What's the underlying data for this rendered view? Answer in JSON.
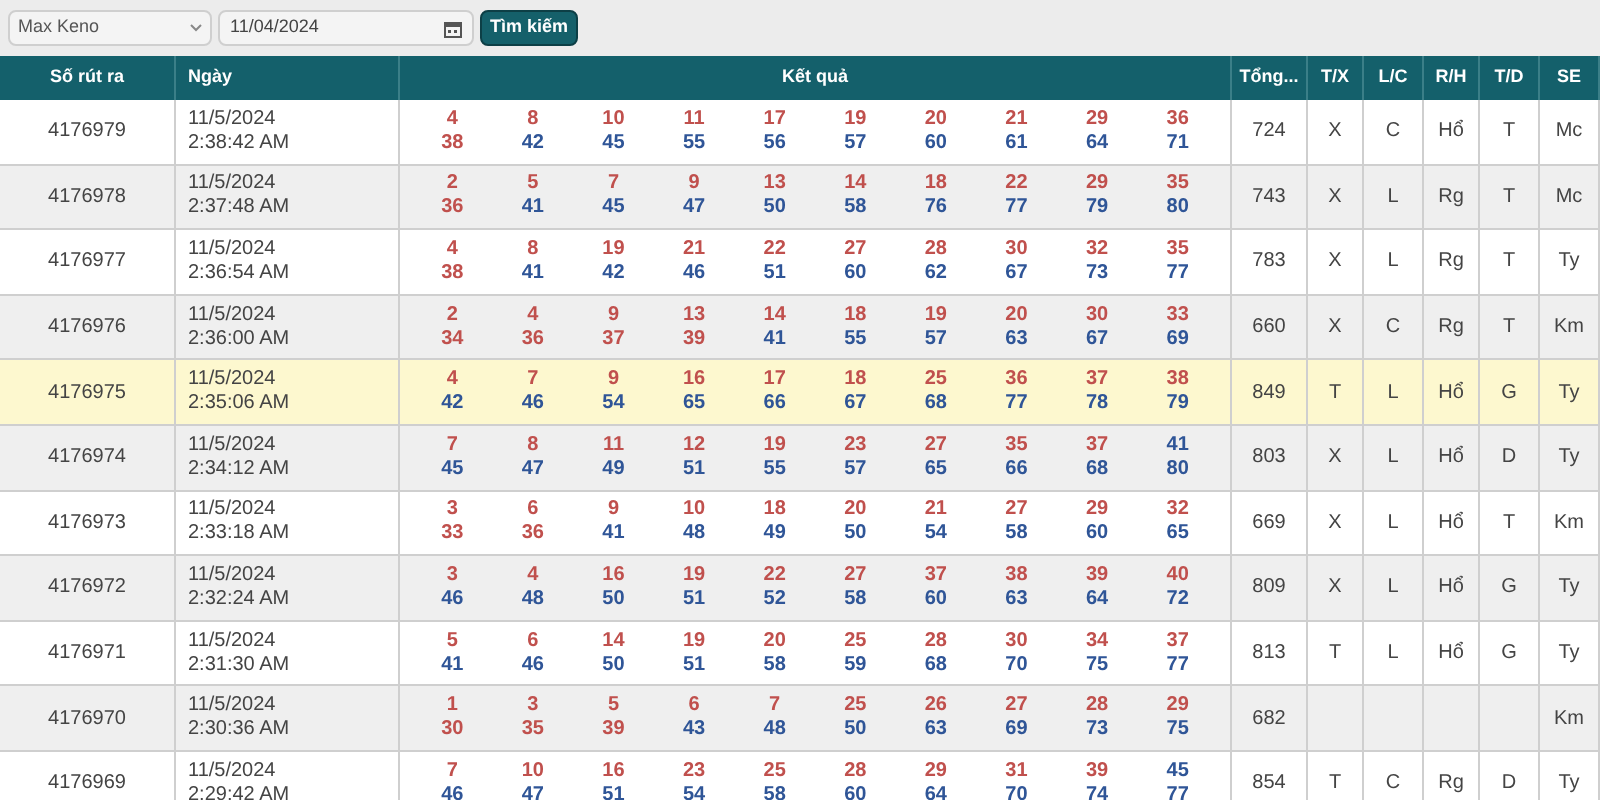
{
  "toolbar": {
    "game": "Max Keno",
    "date": "11/04/2024",
    "search_button": "Tìm kiếm"
  },
  "table": {
    "columns": [
      "Số rút ra",
      "Ngày",
      "Kết quả",
      "Tổng...",
      "T/X",
      "L/C",
      "R/H",
      "T/D",
      "SE"
    ],
    "rows": [
      {
        "draw": "4176979",
        "date": "11/5/2024",
        "time": "2:38:42 AM",
        "selected": false,
        "numbers": [
          "4",
          "8",
          "10",
          "11",
          "17",
          "19",
          "20",
          "21",
          "29",
          "36",
          "38",
          "42",
          "45",
          "55",
          "56",
          "57",
          "60",
          "61",
          "64",
          "71"
        ],
        "total": "724",
        "tx": "X",
        "lc": "C",
        "rh": "Hổ",
        "td": "T",
        "se": "Mc"
      },
      {
        "draw": "4176978",
        "date": "11/5/2024",
        "time": "2:37:48 AM",
        "selected": false,
        "numbers": [
          "2",
          "5",
          "7",
          "9",
          "13",
          "14",
          "18",
          "22",
          "29",
          "35",
          "36",
          "41",
          "45",
          "47",
          "50",
          "58",
          "76",
          "77",
          "79",
          "80"
        ],
        "total": "743",
        "tx": "X",
        "lc": "L",
        "rh": "Rg",
        "td": "T",
        "se": "Mc"
      },
      {
        "draw": "4176977",
        "date": "11/5/2024",
        "time": "2:36:54 AM",
        "selected": false,
        "numbers": [
          "4",
          "8",
          "19",
          "21",
          "22",
          "27",
          "28",
          "30",
          "32",
          "35",
          "38",
          "41",
          "42",
          "46",
          "51",
          "60",
          "62",
          "67",
          "73",
          "77"
        ],
        "total": "783",
        "tx": "X",
        "lc": "L",
        "rh": "Rg",
        "td": "T",
        "se": "Ty"
      },
      {
        "draw": "4176976",
        "date": "11/5/2024",
        "time": "2:36:00 AM",
        "selected": false,
        "numbers": [
          "2",
          "4",
          "9",
          "13",
          "14",
          "18",
          "19",
          "20",
          "30",
          "33",
          "34",
          "36",
          "37",
          "39",
          "41",
          "55",
          "57",
          "63",
          "67",
          "69"
        ],
        "total": "660",
        "tx": "X",
        "lc": "C",
        "rh": "Rg",
        "td": "T",
        "se": "Km"
      },
      {
        "draw": "4176975",
        "date": "11/5/2024",
        "time": "2:35:06 AM",
        "selected": true,
        "numbers": [
          "4",
          "7",
          "9",
          "16",
          "17",
          "18",
          "25",
          "36",
          "37",
          "38",
          "42",
          "46",
          "54",
          "65",
          "66",
          "67",
          "68",
          "77",
          "78",
          "79"
        ],
        "total": "849",
        "tx": "T",
        "lc": "L",
        "rh": "Hổ",
        "td": "G",
        "se": "Ty"
      },
      {
        "draw": "4176974",
        "date": "11/5/2024",
        "time": "2:34:12 AM",
        "selected": false,
        "numbers": [
          "7",
          "8",
          "11",
          "12",
          "19",
          "23",
          "27",
          "35",
          "37",
          "41",
          "45",
          "47",
          "49",
          "51",
          "55",
          "57",
          "65",
          "66",
          "68",
          "80"
        ],
        "total": "803",
        "tx": "X",
        "lc": "L",
        "rh": "Hổ",
        "td": "D",
        "se": "Ty"
      },
      {
        "draw": "4176973",
        "date": "11/5/2024",
        "time": "2:33:18 AM",
        "selected": false,
        "numbers": [
          "3",
          "6",
          "9",
          "10",
          "18",
          "20",
          "21",
          "27",
          "29",
          "32",
          "33",
          "36",
          "41",
          "48",
          "49",
          "50",
          "54",
          "58",
          "60",
          "65"
        ],
        "total": "669",
        "tx": "X",
        "lc": "L",
        "rh": "Hổ",
        "td": "T",
        "se": "Km"
      },
      {
        "draw": "4176972",
        "date": "11/5/2024",
        "time": "2:32:24 AM",
        "selected": false,
        "numbers": [
          "3",
          "4",
          "16",
          "19",
          "22",
          "27",
          "37",
          "38",
          "39",
          "40",
          "46",
          "48",
          "50",
          "51",
          "52",
          "58",
          "60",
          "63",
          "64",
          "72"
        ],
        "total": "809",
        "tx": "X",
        "lc": "L",
        "rh": "Hổ",
        "td": "G",
        "se": "Ty"
      },
      {
        "draw": "4176971",
        "date": "11/5/2024",
        "time": "2:31:30 AM",
        "selected": false,
        "numbers": [
          "5",
          "6",
          "14",
          "19",
          "20",
          "25",
          "28",
          "30",
          "34",
          "37",
          "41",
          "46",
          "50",
          "51",
          "58",
          "59",
          "68",
          "70",
          "75",
          "77"
        ],
        "total": "813",
        "tx": "T",
        "lc": "L",
        "rh": "Hổ",
        "td": "G",
        "se": "Ty"
      },
      {
        "draw": "4176970",
        "date": "11/5/2024",
        "time": "2:30:36 AM",
        "selected": false,
        "numbers": [
          "1",
          "3",
          "5",
          "6",
          "7",
          "25",
          "26",
          "27",
          "28",
          "29",
          "30",
          "35",
          "39",
          "43",
          "48",
          "50",
          "63",
          "69",
          "73",
          "75"
        ],
        "total": "682",
        "se": "Km"
      },
      {
        "draw": "4176969",
        "date": "11/5/2024",
        "time": "2:29:42 AM",
        "selected": false,
        "numbers": [
          "7",
          "10",
          "16",
          "23",
          "25",
          "28",
          "29",
          "31",
          "39",
          "45",
          "46",
          "47",
          "51",
          "54",
          "58",
          "60",
          "64",
          "70",
          "74",
          "77"
        ],
        "total": "854",
        "tx": "T",
        "lc": "C",
        "rh": "Rg",
        "td": "D",
        "se": "Ty"
      }
    ]
  }
}
